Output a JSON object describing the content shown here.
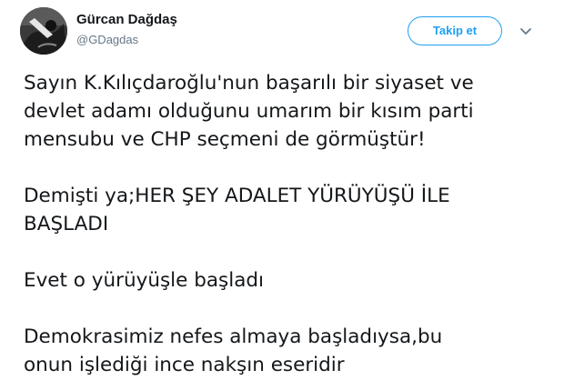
{
  "user": {
    "display_name": "Gürcan Dağdaş",
    "handle": "@GDagdas",
    "avatar_icon": "profile-photo"
  },
  "follow_button": {
    "label": "Takip et",
    "color": "#1da1f2"
  },
  "menu": {
    "icon": "chevron-down-icon"
  },
  "tweet": {
    "lines": [
      "Sayın K.Kılıçdaroğlu'nun başarılı bir siyaset ve",
      "devlet adamı olduğunu umarım bir kısım parti",
      "mensubu ve CHP seçmeni de görmüştür!",
      "Demişti ya;HER ŞEY ADALET YÜRÜYÜŞÜ İLE",
      "BAŞLADI",
      "Evet o yürüyüşle başladı",
      "Demokrasimiz nefes almaya başladıysa,bu",
      "onun işlediği ince nakşın eseridir"
    ]
  }
}
